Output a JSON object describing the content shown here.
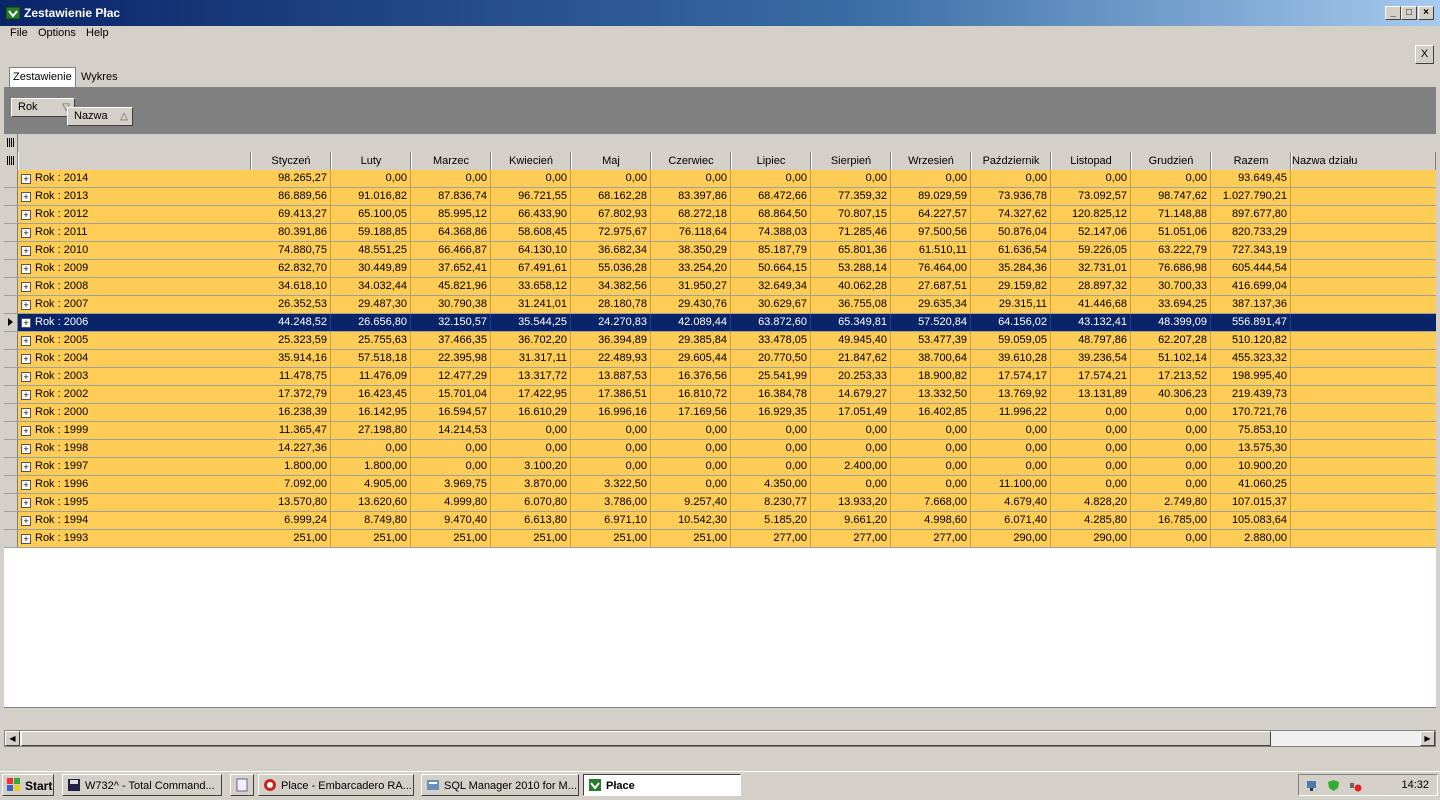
{
  "window": {
    "title": "Zestawienie Płac"
  },
  "menu": [
    "File",
    "Options",
    "Help"
  ],
  "close_label": "X",
  "tabs": [
    "Zestawienie",
    "Wykres"
  ],
  "group": {
    "rok": "Rok",
    "nazwa": "Nazwa"
  },
  "columns": [
    "Styczeń",
    "Luty",
    "Marzec",
    "Kwiecień",
    "Maj",
    "Czerwiec",
    "Lipiec",
    "Sierpień",
    "Wrzesień",
    "Październik",
    "Listopad",
    "Grudzień",
    "Razem",
    "Nazwa działu"
  ],
  "rows": [
    {
      "label": "Rok : 2014",
      "values": [
        "98.265,27",
        "0,00",
        "0,00",
        "0,00",
        "0,00",
        "0,00",
        "0,00",
        "0,00",
        "0,00",
        "0,00",
        "0,00",
        "0,00",
        "93.649,45"
      ]
    },
    {
      "label": "Rok : 2013",
      "values": [
        "86.889,56",
        "91.016,82",
        "87.836,74",
        "96.721,55",
        "68.162,28",
        "83.397,86",
        "68.472,66",
        "77.359,32",
        "89.029,59",
        "73.936,78",
        "73.092,57",
        "98.747,62",
        "1.027.790,21"
      ]
    },
    {
      "label": "Rok : 2012",
      "values": [
        "69.413,27",
        "65.100,05",
        "85.995,12",
        "66.433,90",
        "67.802,93",
        "68.272,18",
        "68.864,50",
        "70.807,15",
        "64.227,57",
        "74.327,62",
        "120.825,12",
        "71.148,88",
        "897.677,80"
      ]
    },
    {
      "label": "Rok : 2011",
      "values": [
        "80.391,86",
        "59.188,85",
        "64.368,86",
        "58.608,45",
        "72.975,67",
        "76.118,64",
        "74.388,03",
        "71.285,46",
        "97.500,56",
        "50.876,04",
        "52.147,06",
        "51.051,06",
        "820.733,29"
      ]
    },
    {
      "label": "Rok : 2010",
      "values": [
        "74.880,75",
        "48.551,25",
        "66.466,87",
        "64.130,10",
        "36.682,34",
        "38.350,29",
        "85.187,79",
        "65.801,36",
        "61.510,11",
        "61.636,54",
        "59.226,05",
        "63.222,79",
        "727.343,19"
      ]
    },
    {
      "label": "Rok : 2009",
      "values": [
        "62.832,70",
        "30.449,89",
        "37.652,41",
        "67.491,61",
        "55.036,28",
        "33.254,20",
        "50.664,15",
        "53.288,14",
        "76.464,00",
        "35.284,36",
        "32.731,01",
        "76.686,98",
        "605.444,54"
      ]
    },
    {
      "label": "Rok : 2008",
      "values": [
        "34.618,10",
        "34.032,44",
        "45.821,96",
        "33.658,12",
        "34.382,56",
        "31.950,27",
        "32.649,34",
        "40.062,28",
        "27.687,51",
        "29.159,82",
        "28.897,32",
        "30.700,33",
        "416.699,04"
      ]
    },
    {
      "label": "Rok : 2007",
      "values": [
        "26.352,53",
        "29.487,30",
        "30.790,38",
        "31.241,01",
        "28.180,78",
        "29.430,76",
        "30.629,67",
        "36.755,08",
        "29.635,34",
        "29.315,11",
        "41.446,68",
        "33.694,25",
        "387.137,36"
      ]
    },
    {
      "label": "Rok : 2006",
      "values": [
        "44.248,52",
        "26.656,80",
        "32.150,57",
        "35.544,25",
        "24.270,83",
        "42.089,44",
        "63.872,60",
        "65.349,81",
        "57.520,84",
        "64.156,02",
        "43.132,41",
        "48.399,09",
        "556.891,47"
      ],
      "selected": true
    },
    {
      "label": "Rok : 2005",
      "values": [
        "25.323,59",
        "25.755,63",
        "37.466,35",
        "36.702,20",
        "36.394,89",
        "29.385,84",
        "33.478,05",
        "49.945,40",
        "53.477,39",
        "59.059,05",
        "48.797,86",
        "62.207,28",
        "510.120,82"
      ]
    },
    {
      "label": "Rok : 2004",
      "values": [
        "35.914,16",
        "57.518,18",
        "22.395,98",
        "31.317,11",
        "22.489,93",
        "29.605,44",
        "20.770,50",
        "21.847,62",
        "38.700,64",
        "39.610,28",
        "39.236,54",
        "51.102,14",
        "455.323,32"
      ]
    },
    {
      "label": "Rok : 2003",
      "values": [
        "11.478,75",
        "11.476,09",
        "12.477,29",
        "13.317,72",
        "13.887,53",
        "16.376,56",
        "25.541,99",
        "20.253,33",
        "18.900,82",
        "17.574,17",
        "17.574,21",
        "17.213,52",
        "198.995,40"
      ]
    },
    {
      "label": "Rok : 2002",
      "values": [
        "17.372,79",
        "16.423,45",
        "15.701,04",
        "17.422,95",
        "17.386,51",
        "16.810,72",
        "16.384,78",
        "14.679,27",
        "13.332,50",
        "13.769,92",
        "13.131,89",
        "40.306,23",
        "219.439,73"
      ]
    },
    {
      "label": "Rok : 2000",
      "values": [
        "16.238,39",
        "16.142,95",
        "16.594,57",
        "16.610,29",
        "16.996,16",
        "17.169,56",
        "16.929,35",
        "17.051,49",
        "16.402,85",
        "11.996,22",
        "0,00",
        "0,00",
        "170.721,76"
      ]
    },
    {
      "label": "Rok : 1999",
      "values": [
        "11.365,47",
        "27.198,80",
        "14.214,53",
        "0,00",
        "0,00",
        "0,00",
        "0,00",
        "0,00",
        "0,00",
        "0,00",
        "0,00",
        "0,00",
        "75.853,10"
      ]
    },
    {
      "label": "Rok : 1998",
      "values": [
        "14.227,36",
        "0,00",
        "0,00",
        "0,00",
        "0,00",
        "0,00",
        "0,00",
        "0,00",
        "0,00",
        "0,00",
        "0,00",
        "0,00",
        "13.575,30"
      ]
    },
    {
      "label": "Rok : 1997",
      "values": [
        "1.800,00",
        "1.800,00",
        "0,00",
        "3.100,20",
        "0,00",
        "0,00",
        "0,00",
        "2.400,00",
        "0,00",
        "0,00",
        "0,00",
        "0,00",
        "10.900,20"
      ]
    },
    {
      "label": "Rok : 1996",
      "values": [
        "7.092,00",
        "4.905,00",
        "3.969,75",
        "3.870,00",
        "3.322,50",
        "0,00",
        "4.350,00",
        "0,00",
        "0,00",
        "11.100,00",
        "0,00",
        "0,00",
        "41.060,25"
      ]
    },
    {
      "label": "Rok : 1995",
      "values": [
        "13.570,80",
        "13.620,60",
        "4.999,80",
        "6.070,80",
        "3.786,00",
        "9.257,40",
        "8.230,77",
        "13.933,20",
        "7.668,00",
        "4.679,40",
        "4.828,20",
        "2.749,80",
        "107.015,37"
      ]
    },
    {
      "label": "Rok : 1994",
      "values": [
        "6.999,24",
        "8.749,80",
        "9.470,40",
        "6.613,80",
        "6.971,10",
        "10.542,30",
        "5.185,20",
        "9.661,20",
        "4.998,60",
        "6.071,40",
        "4.285,80",
        "16.785,00",
        "105.083,64"
      ]
    },
    {
      "label": "Rok : 1993",
      "values": [
        "251,00",
        "251,00",
        "251,00",
        "251,00",
        "251,00",
        "251,00",
        "277,00",
        "277,00",
        "277,00",
        "290,00",
        "290,00",
        "0,00",
        "2.880,00"
      ]
    }
  ],
  "taskbar": {
    "start": "Start",
    "items": [
      "W732^ - Total Command...",
      "Place - Embarcadero RA...",
      "SQL Manager 2010 for M...",
      "Płace"
    ],
    "clock": "14:32"
  }
}
